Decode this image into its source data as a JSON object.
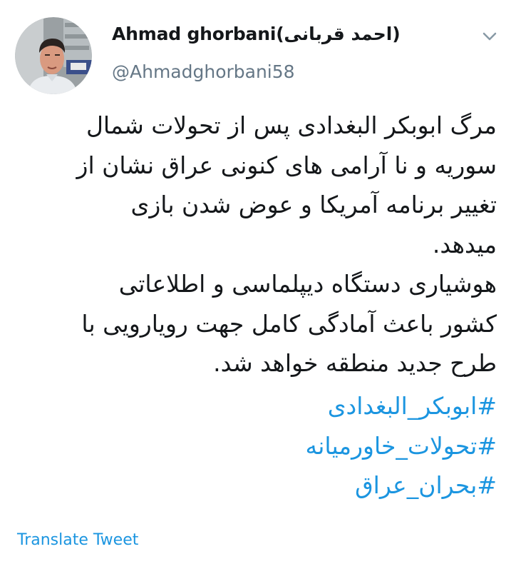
{
  "author": {
    "display_name": "Ahmad ghorbani(احمد قربانی)",
    "handle": "@Ahmadghorbani58",
    "avatar_icon": "profile-photo"
  },
  "menu": {
    "caret_icon": "chevron-down-icon"
  },
  "tweet": {
    "lines": [
      "مرگ ابوبکر البغدادی پس از تحولات شمال",
      "سوریه و نا آرامی های کنونی عراق نشان از",
      "تغییر برنامه آمریکا و عوض شدن بازی",
      "میدهد.",
      "هوشیاری دستگاه دیپلماسی و اطلاعاتی",
      "کشور باعث آمادگی کامل جهت رویارویی با",
      "طرح جدید  منطقه خواهد شد."
    ],
    "hashtags": [
      "#ابوبکر_البغدادی",
      "#تحولات_خاورمیانه",
      "#بحران_عراق"
    ]
  },
  "footer": {
    "translate_label": "Translate Tweet"
  },
  "colors": {
    "text": "#14171a",
    "secondary": "#657786",
    "link": "#1b95e0"
  }
}
